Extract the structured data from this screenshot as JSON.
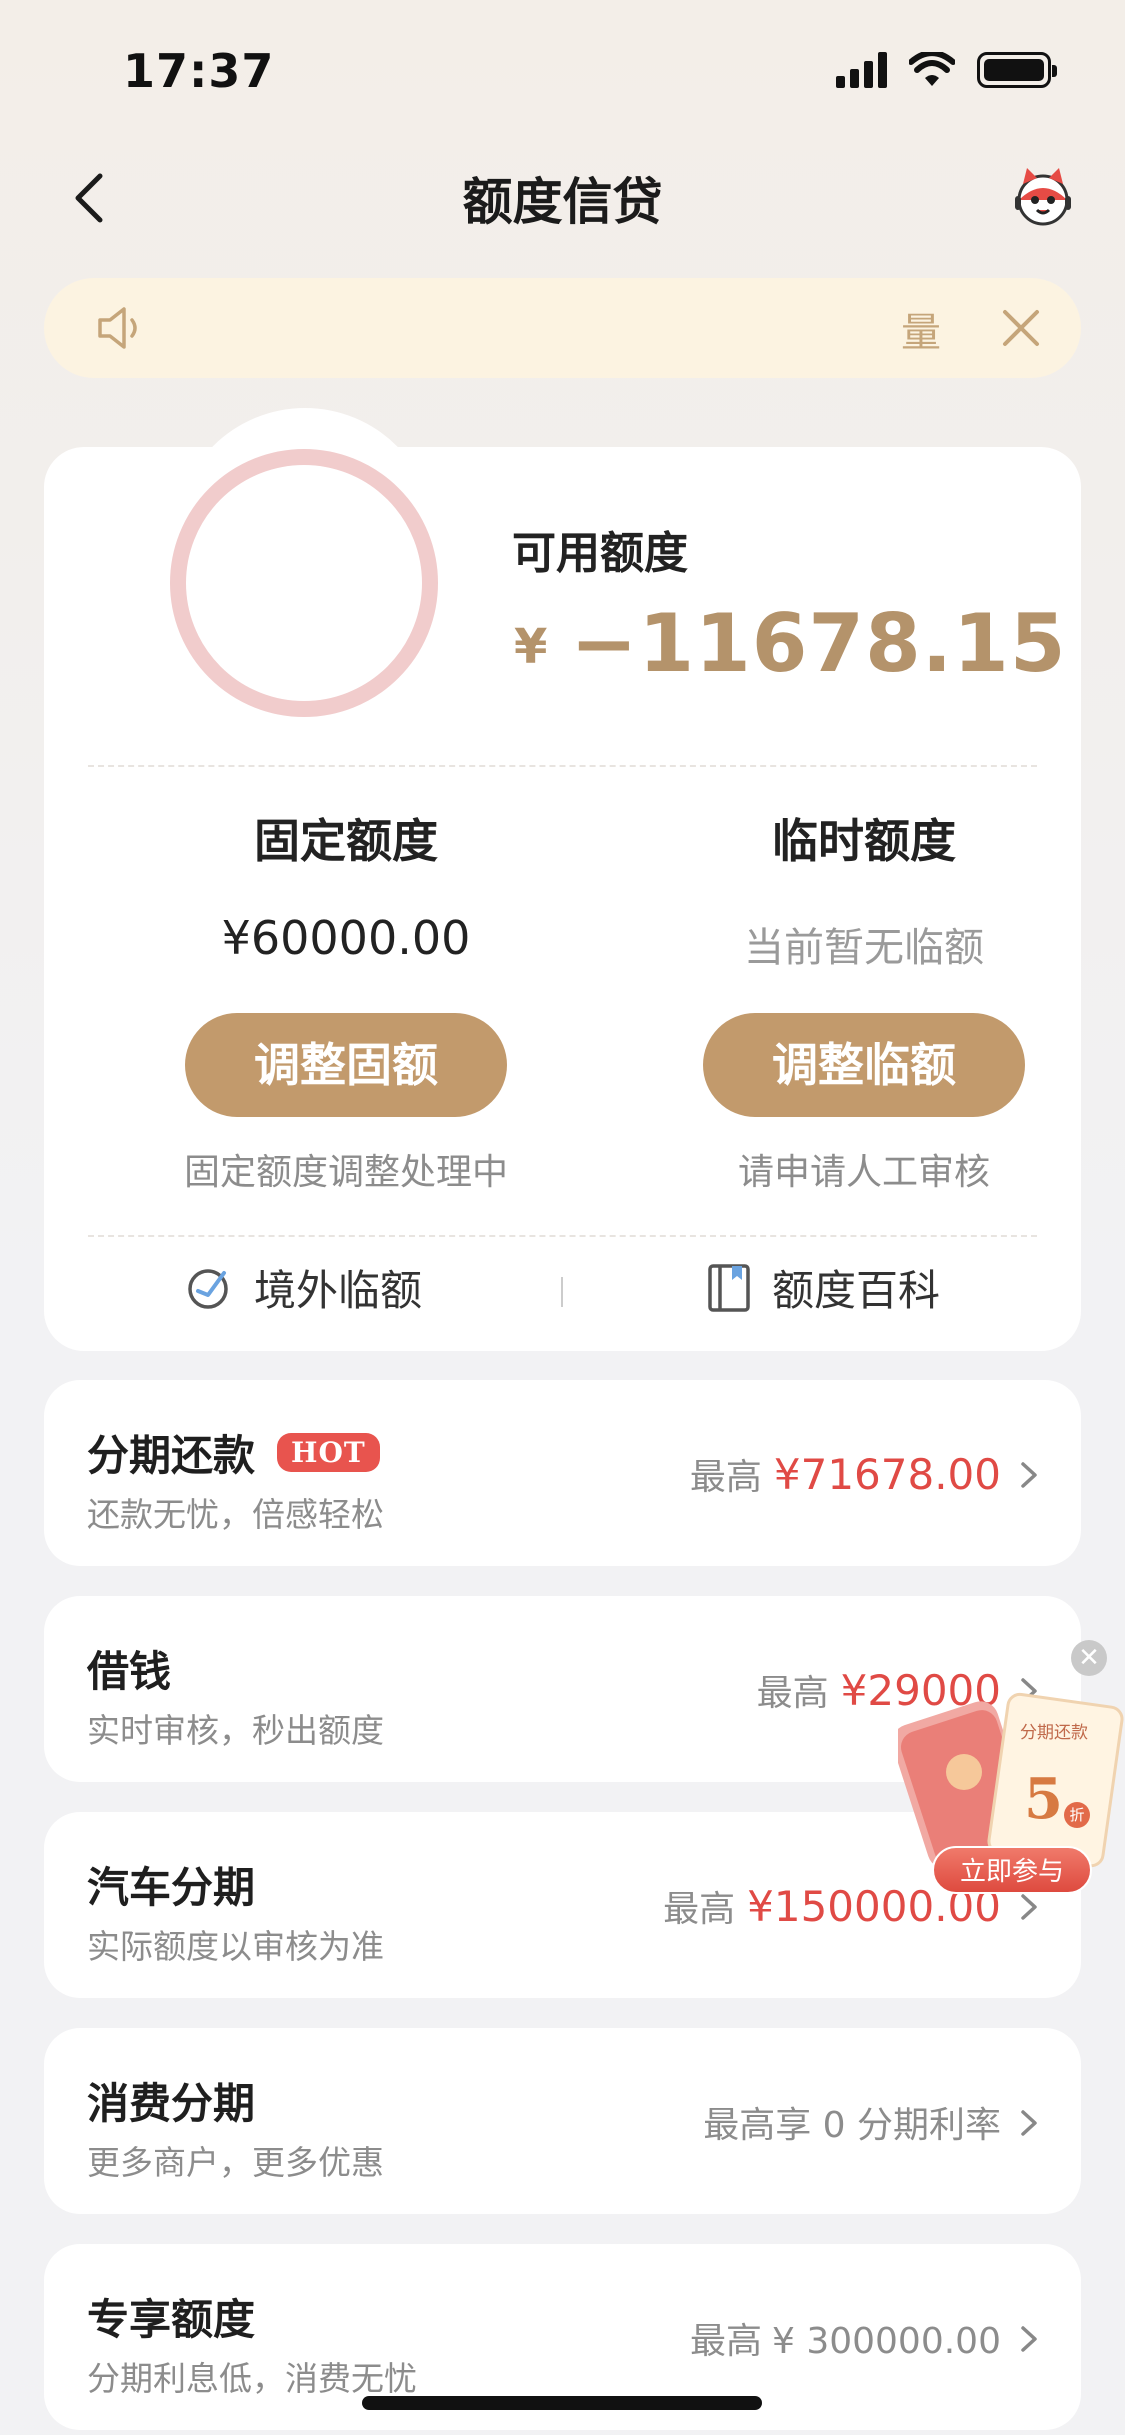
{
  "status_bar": {
    "time": "17:37"
  },
  "nav": {
    "title": "额度信贷"
  },
  "notice": {
    "text": "量"
  },
  "credit": {
    "available_label": "可用额度",
    "available_currency": "¥",
    "available_amount": "−11678.15",
    "fixed": {
      "title": "固定额度",
      "value": "¥60000.00",
      "button": "调整固额",
      "note": "固定额度调整处理中"
    },
    "temporary": {
      "title": "临时额度",
      "value": "当前暂无临额",
      "button": "调整临额",
      "note": "请申请人工审核"
    },
    "links": {
      "overseas": "境外临额",
      "encyclopedia": "额度百科"
    }
  },
  "products": [
    {
      "title": "分期还款",
      "badge": "HOT",
      "subtitle": "还款无忧，倍感轻松",
      "prefix": "最高",
      "amount": "¥71678.00"
    },
    {
      "title": "借钱",
      "subtitle": "实时审核，秒出额度",
      "prefix": "最高",
      "amount": "¥29000"
    },
    {
      "title": "汽车分期",
      "subtitle": "实际额度以审核为准",
      "prefix": "最高",
      "amount": "¥150000.00"
    },
    {
      "title": "消费分期",
      "subtitle": "更多商户，更多优惠",
      "prefix": "最高享 0 分期利率"
    },
    {
      "title": "专享额度",
      "subtitle": "分期利息低，消费无忧",
      "prefix": "最高",
      "amount": "¥ 300000.00"
    }
  ],
  "promo": {
    "title": "分期还款",
    "number": "5",
    "unit": "折",
    "button": "立即参与"
  },
  "colors": {
    "accent_gold": "#c29a6c",
    "amount_red": "#e04a45",
    "notice_bg": "#fcf3e1"
  }
}
